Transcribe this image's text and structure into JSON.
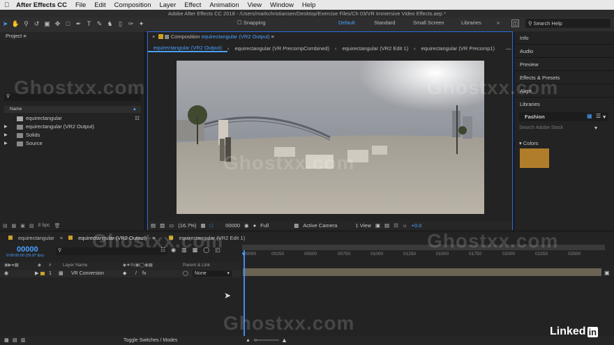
{
  "menubar": {
    "app": "After Effects CC",
    "items": [
      "File",
      "Edit",
      "Composition",
      "Layer",
      "Effect",
      "Animation",
      "View",
      "Window",
      "Help"
    ]
  },
  "window_title": "Adobe After Effects CC 2018 - /Users/markchristiansen/Desktop/Exercise Files/Ch 03/VR Immersive Video Effects.aep *",
  "toolbar": {
    "snapping": "Snapping",
    "workspaces": [
      "Default",
      "Standard",
      "Small Screen",
      "Libraries"
    ],
    "search_placeholder": "Search Help"
  },
  "project": {
    "title": "Project",
    "search_placeholder": "",
    "column_name": "Name",
    "items": [
      {
        "label": "equirectangular",
        "type": "comp"
      },
      {
        "label": "equirectangular (VR2 Output)",
        "type": "folder"
      },
      {
        "label": "Solids",
        "type": "folder"
      },
      {
        "label": "Source",
        "type": "folder"
      }
    ],
    "bpc": "8 bpc"
  },
  "composition": {
    "header_prefix": "Composition",
    "header_name": "equirectangular (VR2 Output)",
    "tabs": [
      "equirectangular (VR2 Output)",
      "equirectangular (VR PrecompCombined)",
      "equirectangular (VR2 Edit 1)",
      "equirectangular (VR Precomp1)"
    ],
    "footer": {
      "zoom": "(16.7%)",
      "timecode": "00000",
      "resolution": "Full",
      "camera": "Active Camera",
      "views": "1 View",
      "exposure": "+0.0"
    }
  },
  "right_panel": {
    "items": [
      "Info",
      "Audio",
      "Preview",
      "Effects & Presets",
      "Align",
      "Libraries"
    ],
    "library_name": "Fashion",
    "stock_placeholder": "Search Adobe Stock",
    "colors_label": "Colors",
    "swatch": "#b07d2b"
  },
  "timeline": {
    "tabs": [
      "equirectangular",
      "equirectangular (VR2 Output)",
      "equirectangular (VR2 Edit 1)"
    ],
    "timecode": "00000",
    "timecode_sub": "0:00:00:00 (29.97 fps)",
    "col_layer_name": "Layer Name",
    "col_parent": "Parent & Link",
    "layer": {
      "num": "1",
      "name": "VR Conversion",
      "parent": "None"
    },
    "ruler": [
      "00000",
      "00250",
      "00500",
      "00750",
      "01000",
      "01250",
      "01500",
      "01750",
      "02000",
      "02250",
      "02500"
    ],
    "toggle_label": "Toggle Switches / Modes"
  },
  "watermark": "Ghostxx.com",
  "linkedin": "Linked"
}
